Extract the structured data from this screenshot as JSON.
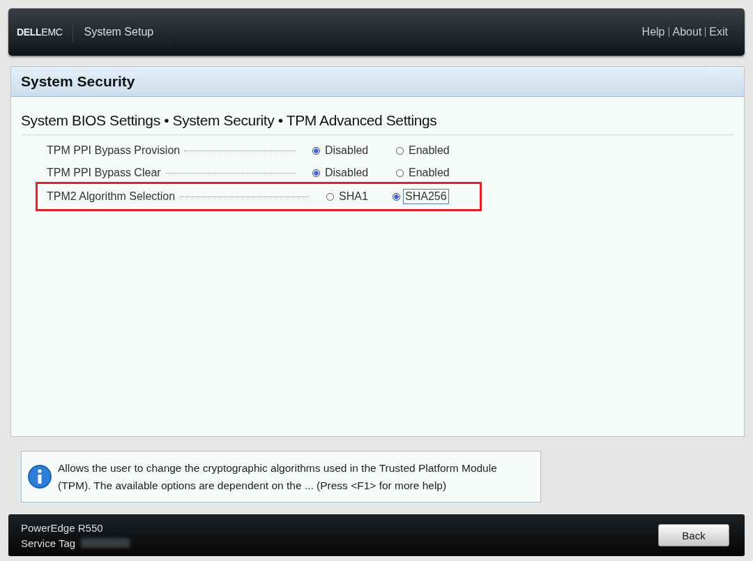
{
  "header": {
    "logo": "**DELL**EMC",
    "title": "System Setup",
    "links": [
      "Help",
      "About",
      "Exit"
    ]
  },
  "panel": {
    "title": "System Security",
    "breadcrumb": "System BIOS Settings • System Security • TPM Advanced Settings",
    "settings": [
      {
        "label": "TPM PPI Bypass Provision",
        "highlighted": false,
        "options": [
          {
            "label": "Disabled",
            "selected": true,
            "focused": false
          },
          {
            "label": "Enabled",
            "selected": false,
            "focused": false
          }
        ]
      },
      {
        "label": "TPM PPI Bypass Clear",
        "highlighted": false,
        "options": [
          {
            "label": "Disabled",
            "selected": true,
            "focused": false
          },
          {
            "label": "Enabled",
            "selected": false,
            "focused": false
          }
        ]
      },
      {
        "label": "TPM2 Algorithm Selection",
        "highlighted": true,
        "options": [
          {
            "label": "SHA1",
            "selected": false,
            "focused": false
          },
          {
            "label": "SHA256",
            "selected": true,
            "focused": true
          }
        ]
      }
    ]
  },
  "help": {
    "text": "Allows the user to change the cryptographic algorithms used in the Trusted Platform Module (TPM). The available options are dependent on the ... (Press <F1> for more help)"
  },
  "footer": {
    "model": "PowerEdge R550",
    "service_tag_label": "Service Tag",
    "service_tag_redacted": true,
    "button": "Back"
  }
}
